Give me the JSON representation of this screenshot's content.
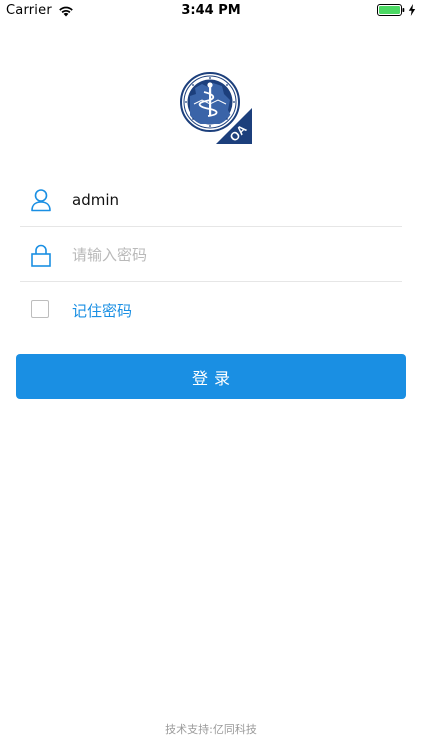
{
  "status_bar": {
    "carrier": "Carrier",
    "time": "3:44 PM",
    "icons": [
      "wifi-icon",
      "battery-icon",
      "charging-icon"
    ],
    "battery_color": "#4cd964"
  },
  "logo": {
    "badge": "OA"
  },
  "login_form": {
    "username": {
      "icon": "user-icon",
      "value": "admin",
      "placeholder": ""
    },
    "password": {
      "icon": "lock-icon",
      "value": "",
      "placeholder": "请输入密码"
    },
    "remember": {
      "label": "记住密码",
      "checked": false
    },
    "submit_label": "登录"
  },
  "footer": {
    "text": "技术支持:亿同科技"
  },
  "colors": {
    "accent": "#1a8fe3",
    "logo_navy": "#1c3f7c",
    "divider": "#e6e6e6",
    "placeholder": "#b9b9b9"
  }
}
